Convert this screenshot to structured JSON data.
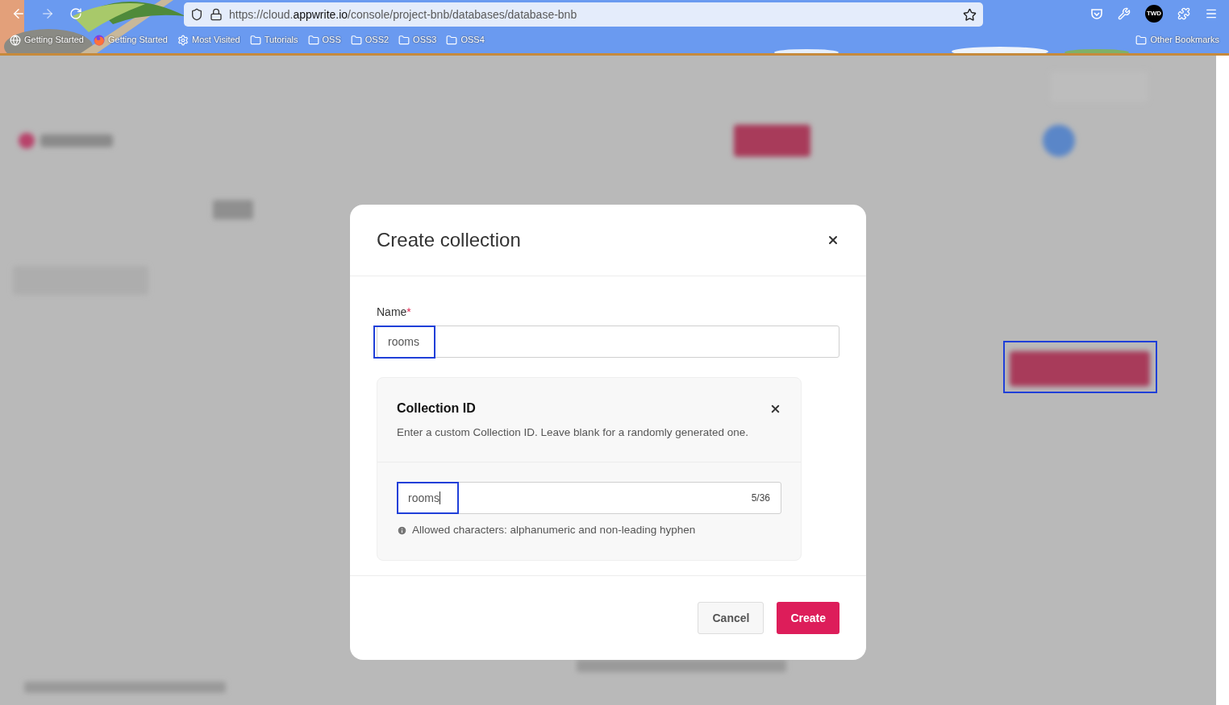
{
  "browser": {
    "url": {
      "prefix": "https://cloud.",
      "domain": "appwrite.io",
      "path": "/console/project-bnb/databases/database-bnb"
    },
    "profile_badge": "TWD",
    "bookmarks": [
      {
        "kind": "globe",
        "label": "Getting Started"
      },
      {
        "kind": "firefox",
        "label": "Getting Started"
      },
      {
        "kind": "gear",
        "label": "Most Visited"
      },
      {
        "kind": "folder",
        "label": "Tutorials"
      },
      {
        "kind": "folder",
        "label": "OSS"
      },
      {
        "kind": "folder",
        "label": "OSS2"
      },
      {
        "kind": "folder",
        "label": "OSS3"
      },
      {
        "kind": "folder",
        "label": "OSS4"
      }
    ],
    "other_bookmarks": "Other Bookmarks"
  },
  "dialog": {
    "title": "Create collection",
    "name_label": "Name",
    "required_mark": "*",
    "name_value": "rooms",
    "id_card": {
      "title": "Collection ID",
      "description": "Enter a custom Collection ID. Leave blank for a randomly generated one.",
      "value": "rooms",
      "counter": "5/36",
      "hint": "Allowed characters: alphanumeric and non-leading hyphen"
    },
    "buttons": [
      {
        "kind": "secondary",
        "label": "Cancel"
      },
      {
        "kind": "primary",
        "label": "Create"
      }
    ]
  }
}
